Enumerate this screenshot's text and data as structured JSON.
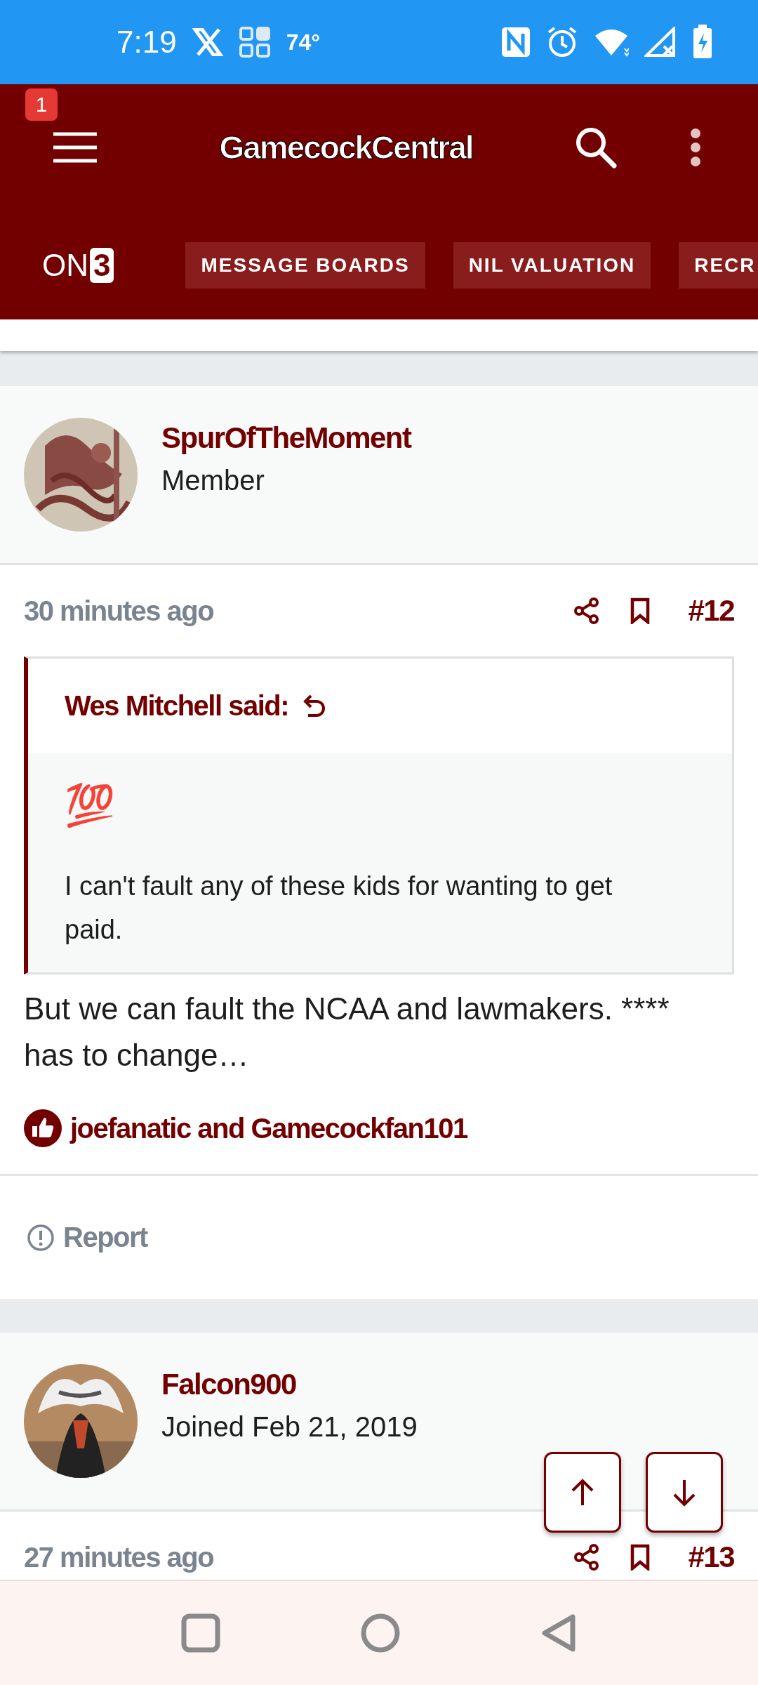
{
  "status_bar": {
    "time": "7:19",
    "temperature": "74°"
  },
  "header": {
    "notification_count": "1",
    "site_title": "GamecockCentral",
    "brand": {
      "prefix": "ON",
      "suffix": "3"
    },
    "nav_tabs": [
      {
        "label": "MESSAGE BOARDS"
      },
      {
        "label": "NIL VALUATION"
      },
      {
        "label": "RECR"
      }
    ]
  },
  "posts": [
    {
      "author": "SpurOfTheMoment",
      "subtitle": "Member",
      "time": "30 minutes ago",
      "number": "#12",
      "quote": {
        "attribution": "Wes Mitchell said:",
        "paragraphs": [
          "💯",
          "I can't fault any of these kids for wanting to get paid."
        ]
      },
      "body": "But we can fault the NCAA and lawmakers. **** has to change…",
      "reactions": "joefanatic and Gamecockfan101",
      "report": "Report"
    },
    {
      "author": "Falcon900",
      "subtitle": "Joined Feb 21, 2019",
      "time": "27 minutes ago",
      "number": "#13"
    }
  ]
}
